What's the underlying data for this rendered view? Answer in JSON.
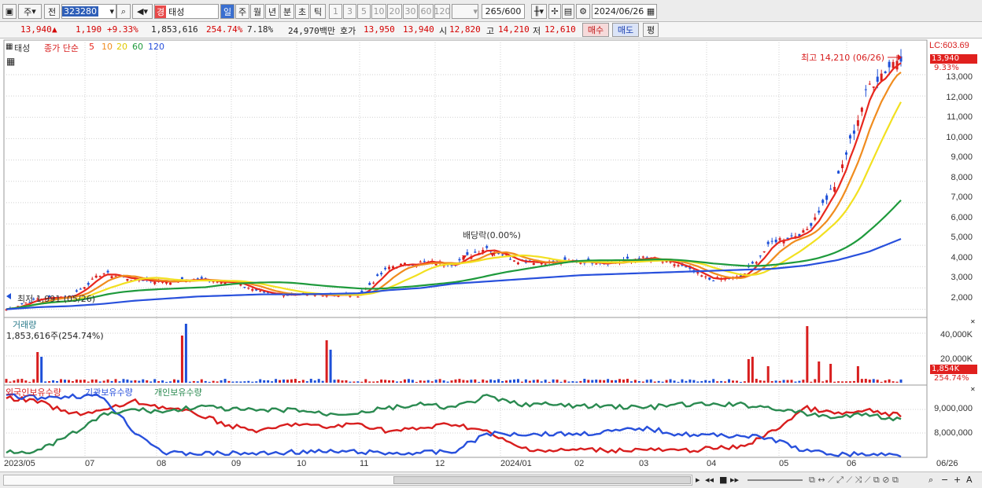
{
  "toolbar": {
    "market": "주",
    "kind": "전",
    "code": "323280",
    "stock_badge": "경",
    "stock_name": "태성",
    "periods": [
      "일",
      "주",
      "월",
      "년",
      "분",
      "초",
      "틱"
    ],
    "active_period": "일",
    "intervals": [
      "1",
      "3",
      "5",
      "10",
      "20",
      "30",
      "60",
      "120"
    ],
    "count": "265",
    "count_max": "/600",
    "date": "2024/06/26"
  },
  "info": {
    "price": "13,940",
    "arrow": "▲",
    "change": "1,190",
    "change_pct": "+9.33%",
    "volume": "1,853,616",
    "volume_ratio": "254.74%",
    "turnover_pct": "7.18%",
    "amount": "24,970백만",
    "bid_label": "호가",
    "bid1": "13,950",
    "bid2": "13,940",
    "open_label": "시",
    "open": "12,820",
    "high_label": "고",
    "high": "14,210",
    "low_label": "저",
    "low": "12,610",
    "buy_label": "매수",
    "sell_label": "매도",
    "eval_label": "평"
  },
  "price_panel": {
    "stock": "태성",
    "ma_title": "종가 단순",
    "ma_periods": [
      "5",
      "10",
      "20",
      "60",
      "120"
    ],
    "ma_colors": [
      "#e8281e",
      "#f08c1e",
      "#f2e020",
      "#1e9a3c",
      "#2850dc"
    ],
    "lc_label": "LC:603.69",
    "last_price_tag": "13,940",
    "last_pct_tag": "9.33%",
    "y_ticks": [
      "13,000",
      "12,000",
      "11,000",
      "10,000",
      "9,000",
      "8,000",
      "7,000",
      "6,000",
      "5,000",
      "4,000",
      "3,000",
      "2,000"
    ],
    "high_note": "최고 14,210 (06/26)",
    "low_note": "최저 1,991 (05/26)",
    "dividend_note": "배당락(0.00%)"
  },
  "volume_panel": {
    "title": "거래량",
    "current": "1,853,616주(254.74%)",
    "y_ticks": [
      "40,000K",
      "20,000K"
    ],
    "last_tag": "1,854K",
    "pct_tag": "254.74%"
  },
  "holder_panel": {
    "legend": [
      "외국인보유수량",
      "기관보유수량",
      "개인보유수량"
    ],
    "colors": [
      "#d81e1e",
      "#2850dc",
      "#2a8a50"
    ],
    "y_ticks": [
      "9,000,000",
      "8,000,000"
    ]
  },
  "x_labels": [
    "2023/05",
    "07",
    "08",
    "09",
    "10",
    "11",
    "12",
    "2024/01",
    "02",
    "03",
    "04",
    "05",
    "06",
    "06/26"
  ],
  "chart_data": {
    "type": "line",
    "x_range": [
      "2023/05",
      "2024/06/26"
    ],
    "ylim": [
      1800,
      14400
    ],
    "last_close": 13940,
    "high": 14210,
    "low": 1991,
    "series": [
      {
        "name": "종가",
        "values": [
          2000,
          2500,
          2600,
          3700,
          3400,
          3300,
          3400,
          3300,
          2800,
          2650,
          2700,
          2650,
          4000,
          4200,
          4150,
          4900,
          4300,
          4200,
          4250,
          4200,
          4400,
          4100,
          3400,
          3500,
          5200,
          5600,
          8000,
          12500,
          13940
        ]
      },
      {
        "name": "5",
        "values": [
          2000,
          2450,
          2600,
          3600,
          3350,
          3300,
          3350,
          3250,
          2850,
          2650,
          2700,
          2700,
          3900,
          4150,
          4150,
          4700,
          4200,
          4250,
          4250,
          4250,
          4350,
          4100,
          3450,
          3550,
          5000,
          5500,
          7500,
          12000,
          12900
        ]
      },
      {
        "name": "120",
        "values": [
          2000,
          2100,
          2150,
          2250,
          2400,
          2500,
          2600,
          2650,
          2700,
          2700,
          2720,
          2750,
          2900,
          3000,
          3200,
          3300,
          3400,
          3500,
          3600,
          3650,
          3700,
          3750,
          3800,
          3850,
          3900,
          4050,
          4300,
          4700,
          5300
        ]
      }
    ]
  }
}
